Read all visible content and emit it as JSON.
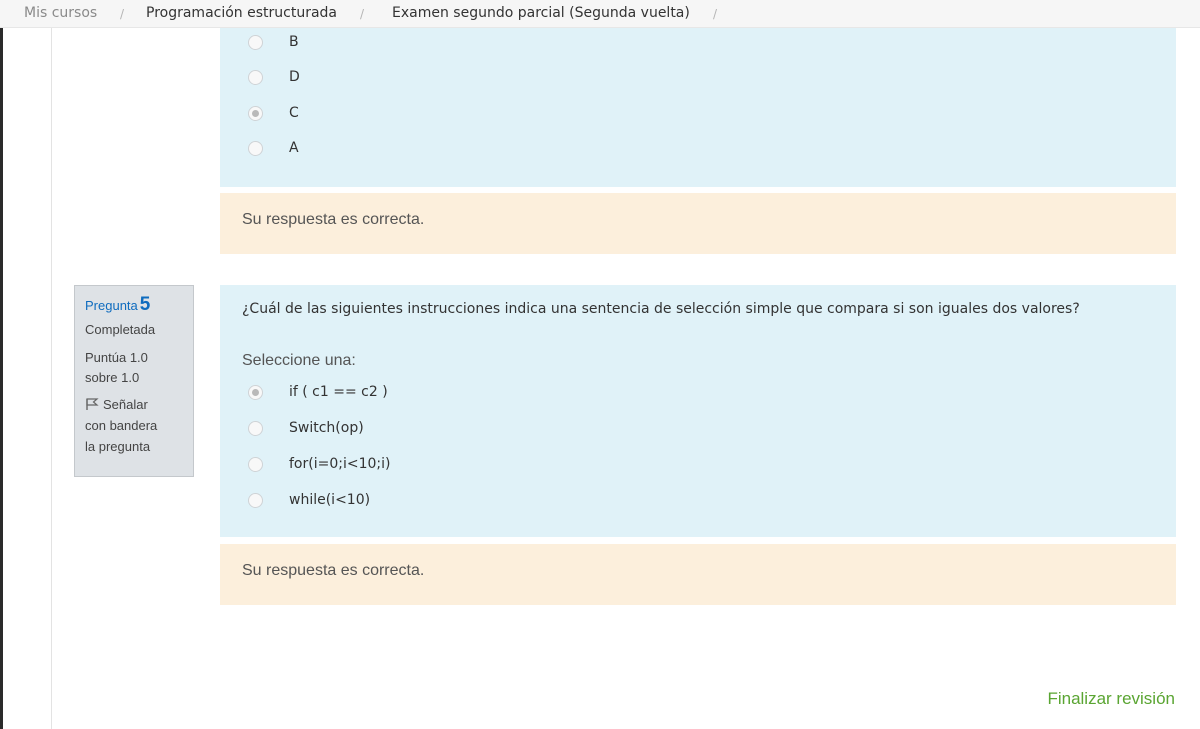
{
  "breadcrumb": {
    "items": [
      {
        "label": "Mis cursos"
      },
      {
        "label": "Programación estructurada"
      },
      {
        "label": "Examen segundo parcial (Segunda vuelta)"
      }
    ],
    "separator": "/"
  },
  "previous_question": {
    "options": [
      {
        "label": "B",
        "selected": false
      },
      {
        "label": "D",
        "selected": false
      },
      {
        "label": "C",
        "selected": true
      },
      {
        "label": "A",
        "selected": false
      }
    ],
    "feedback": "Su respuesta es correcta."
  },
  "question5": {
    "info": {
      "label": "Pregunta",
      "number": "5",
      "state": "Completada",
      "grade_line1": "Puntúa 1.0",
      "grade_line2": "sobre 1.0",
      "flag_line1": "Señalar",
      "flag_line2": "con bandera",
      "flag_line3": "la pregunta"
    },
    "text": "¿Cuál de las siguientes instrucciones indica una sentencia de selección simple que compara si son iguales dos valores?",
    "prompt": "Seleccione una:",
    "options": [
      {
        "label": "if ( c1 == c2 )",
        "selected": true
      },
      {
        "label": "Switch(op)",
        "selected": false
      },
      {
        "label": "for(i=0;i<10;i)",
        "selected": false
      },
      {
        "label": "while(i<10)",
        "selected": false
      }
    ],
    "feedback": "Su respuesta es correcta."
  },
  "footer": {
    "finish_review": "Finalizar revisión"
  },
  "colors": {
    "answer_bg": "#e0f2f8",
    "feedback_bg": "#fcefdc",
    "link_blue": "#0f6cbf",
    "finish_green": "#5aa532"
  },
  "icons": {
    "flag": "flag-icon"
  }
}
